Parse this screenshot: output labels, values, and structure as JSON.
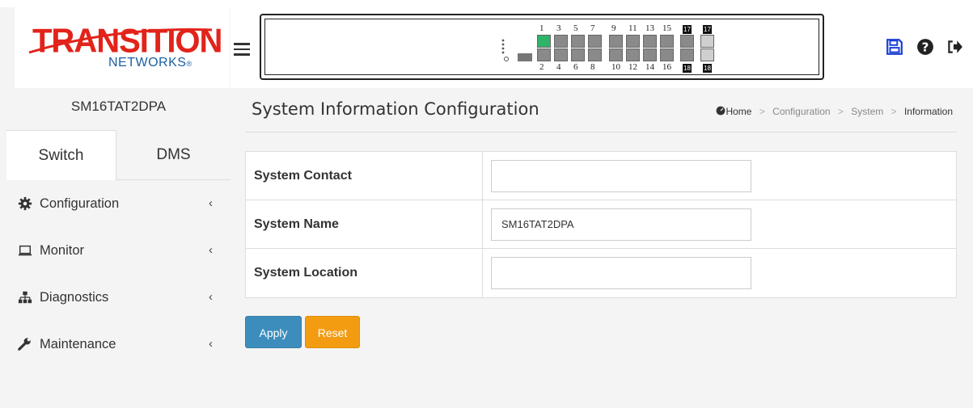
{
  "logo": {
    "main": "TRANSITION",
    "sub": "NETWORKS"
  },
  "device_name": "SM16TAT2DPA",
  "tabs": [
    {
      "label": "Switch"
    },
    {
      "label": "DMS"
    }
  ],
  "menu": {
    "items": [
      {
        "label": "Configuration",
        "icon": "gear-icon"
      },
      {
        "label": "Monitor",
        "icon": "laptop-icon"
      },
      {
        "label": "Diagnostics",
        "icon": "sitemap-icon"
      },
      {
        "label": "Maintenance",
        "icon": "wrench-icon"
      }
    ]
  },
  "ports": {
    "top": [
      "1",
      "3",
      "5",
      "7",
      "9",
      "11",
      "13",
      "15",
      "17",
      "17"
    ],
    "bottom": [
      "2",
      "4",
      "6",
      "8",
      "10",
      "12",
      "14",
      "16",
      "18",
      "18"
    ]
  },
  "header_icons": [
    "save-icon",
    "help-icon",
    "logout-icon"
  ],
  "page": {
    "title": "System Information Configuration",
    "breadcrumb": {
      "home": "Home",
      "items": [
        "Configuration",
        "System",
        "Information"
      ]
    }
  },
  "form": {
    "rows": [
      {
        "label": "System Contact",
        "value": ""
      },
      {
        "label": "System Name",
        "value": "SM16TAT2DPA"
      },
      {
        "label": "System Location",
        "value": ""
      }
    ]
  },
  "buttons": {
    "apply": "Apply",
    "reset": "Reset"
  },
  "colors": {
    "brand_red": "#e2231a",
    "brand_blue": "#1a5fa3",
    "apply": "#3c8dbc",
    "reset": "#f39c12",
    "port_active": "#2fb36a",
    "save_icon": "#1a3fd6"
  }
}
